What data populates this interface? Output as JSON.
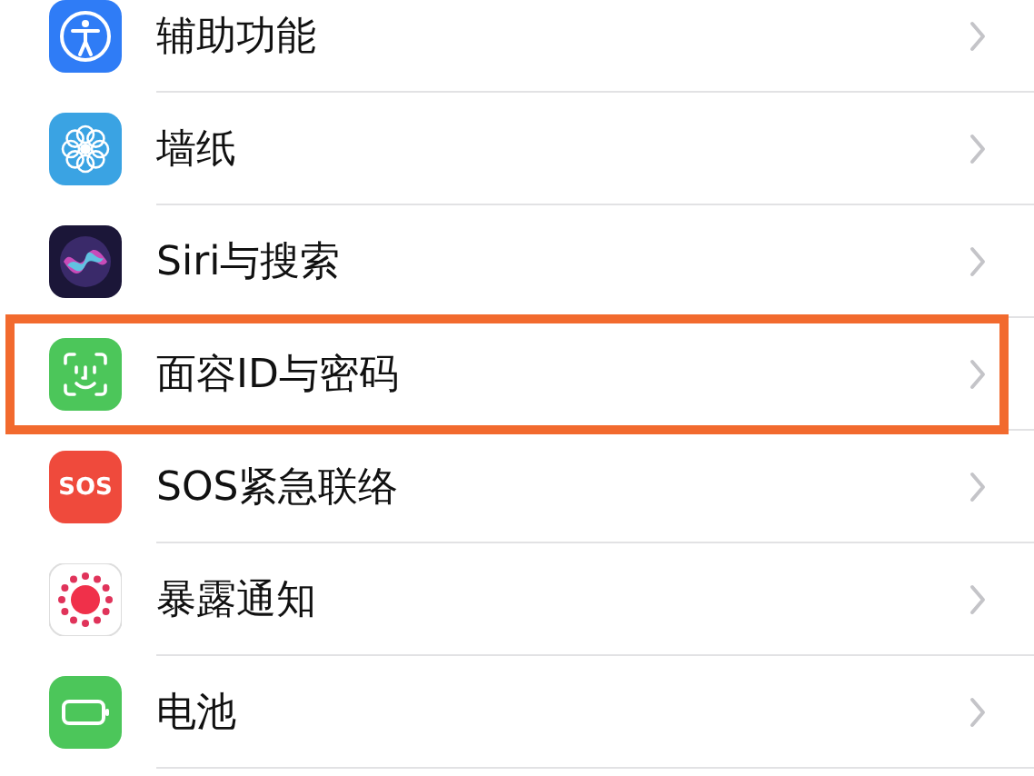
{
  "settings_list": [
    {
      "kind": "accessibility",
      "label": "辅助功能",
      "highlighted": false
    },
    {
      "kind": "wallpaper",
      "label": "墙纸",
      "highlighted": false
    },
    {
      "kind": "siri",
      "label": "Siri与搜索",
      "highlighted": false
    },
    {
      "kind": "faceid",
      "label": "面容ID与密码",
      "highlighted": true
    },
    {
      "kind": "sos",
      "label": "SOS紧急联络",
      "highlighted": false,
      "icon_text": "SOS"
    },
    {
      "kind": "exposure",
      "label": "暴露通知",
      "highlighted": false
    },
    {
      "kind": "battery",
      "label": "电池",
      "highlighted": false
    }
  ]
}
